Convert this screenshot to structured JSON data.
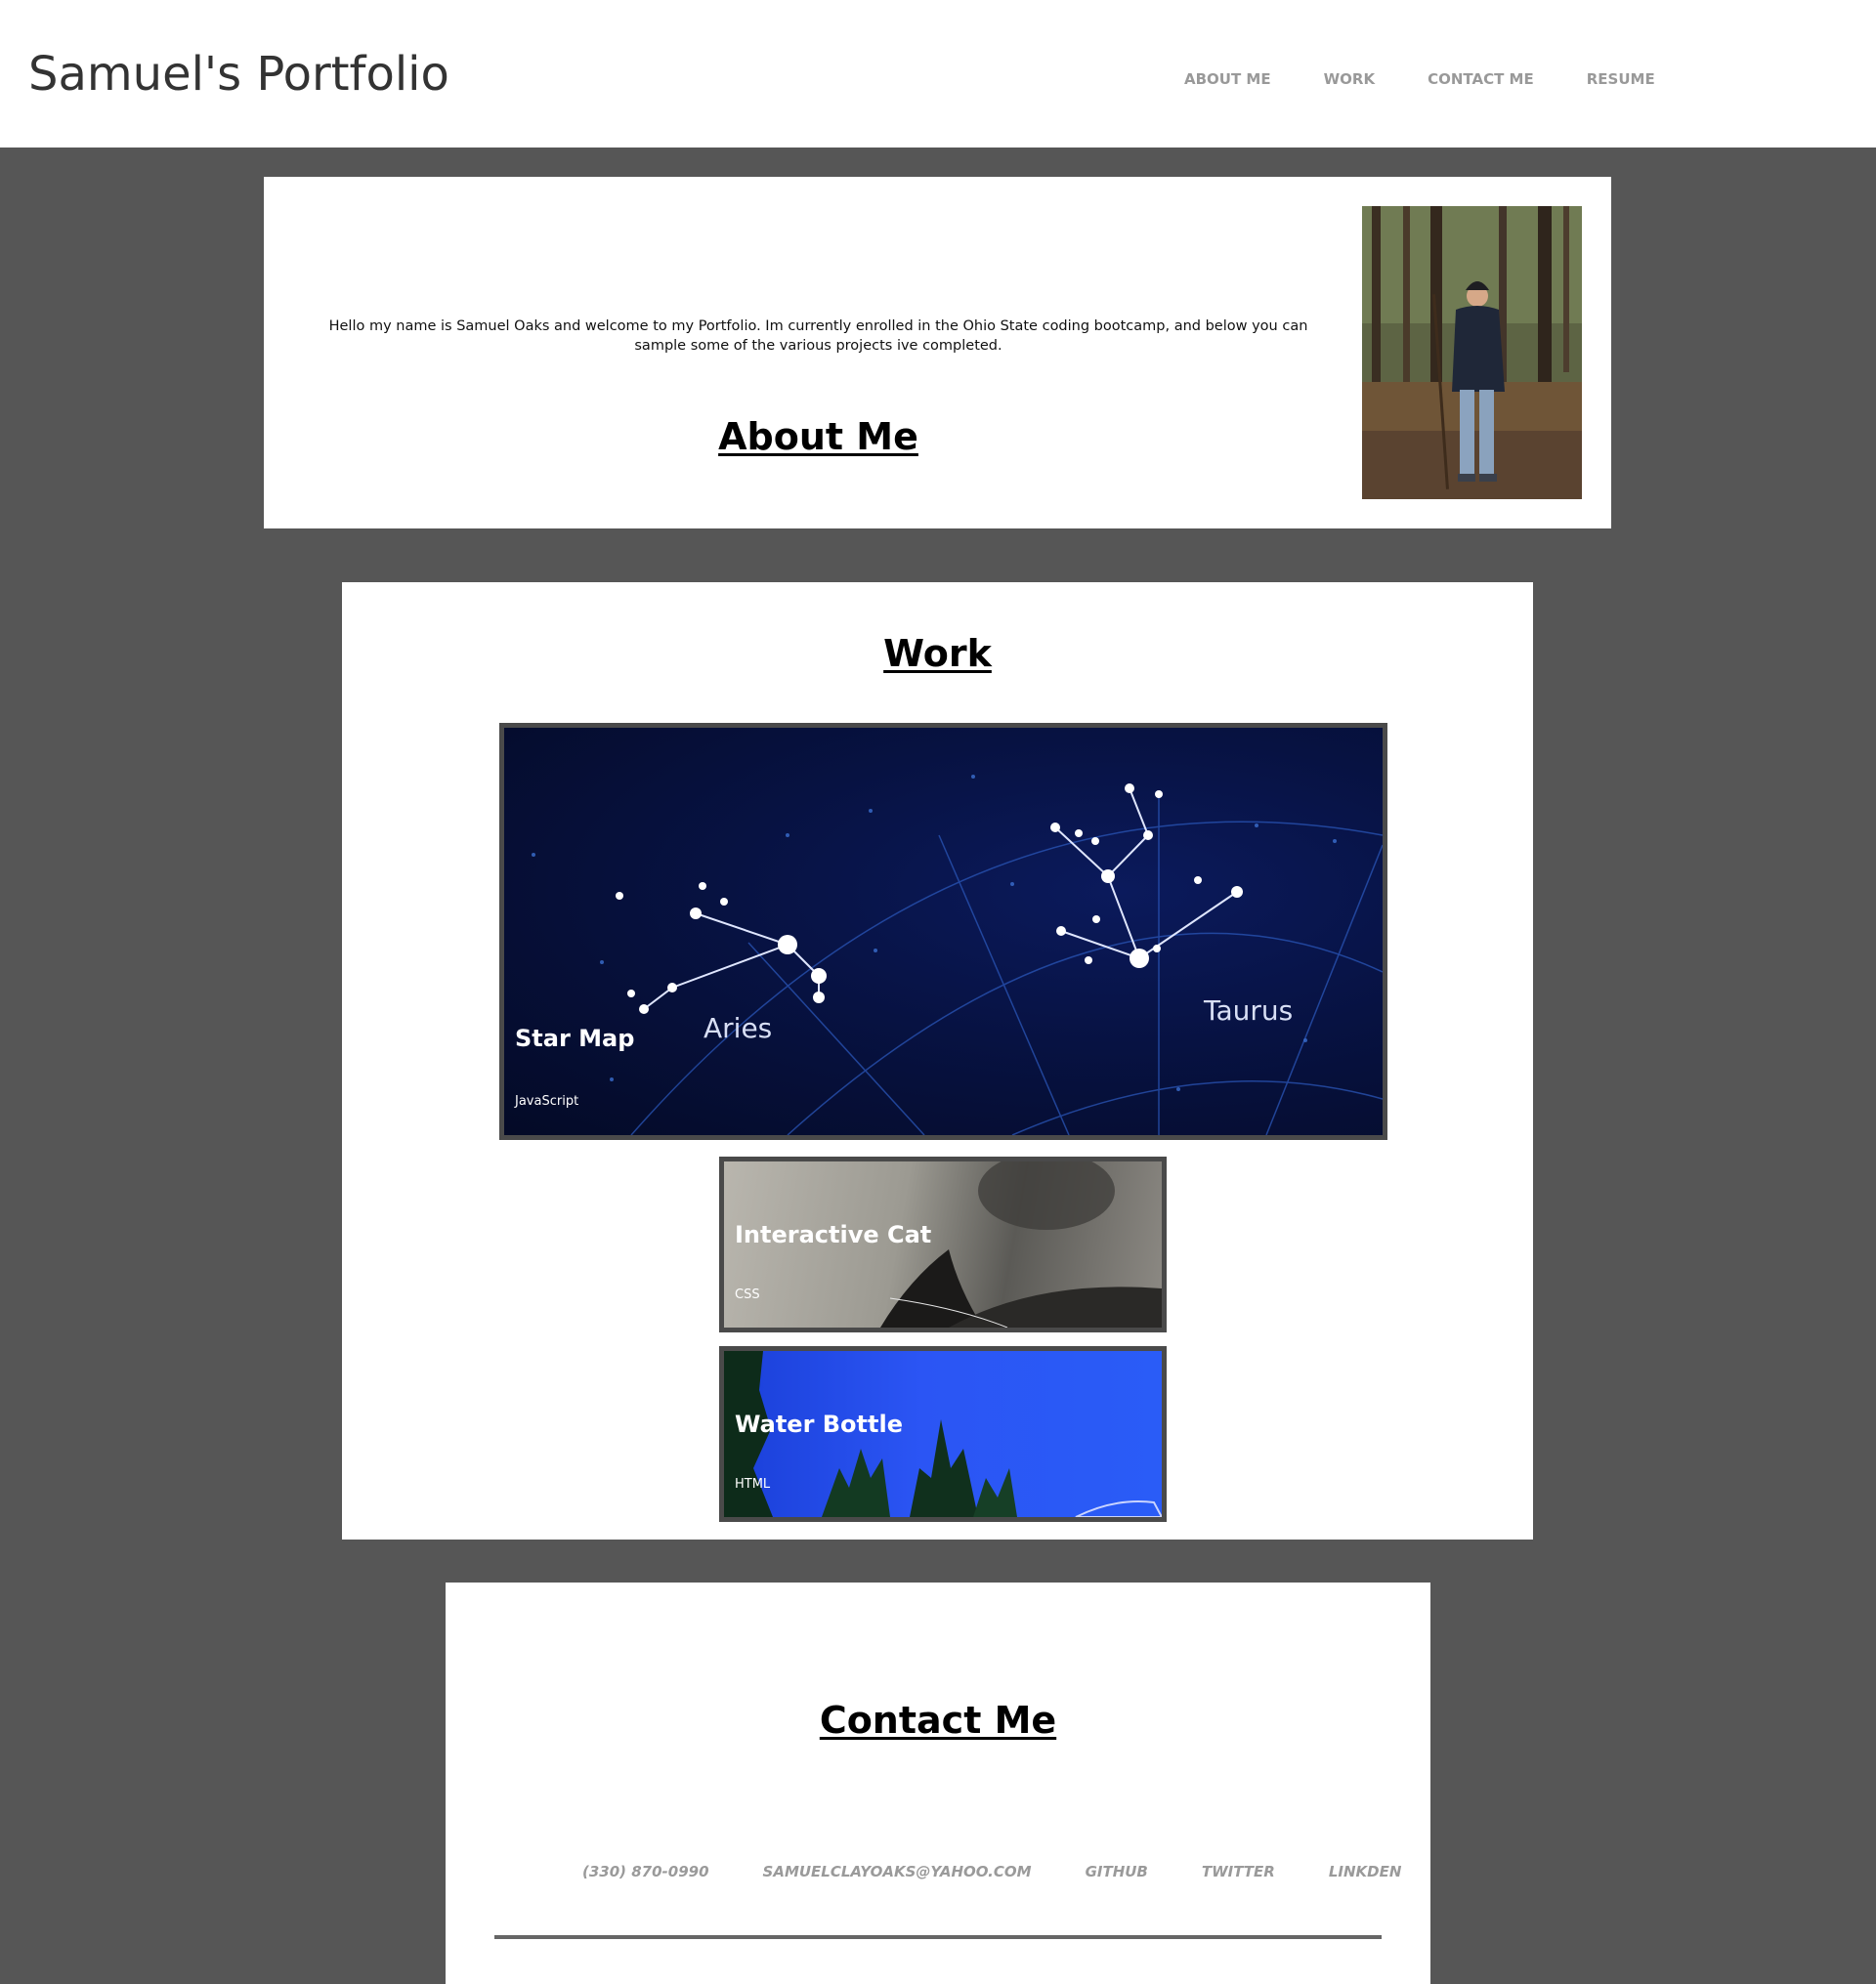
{
  "header": {
    "title": "Samuel's Portfolio",
    "nav": [
      {
        "label": "ABOUT ME"
      },
      {
        "label": "WORK"
      },
      {
        "label": "CONTACT ME"
      },
      {
        "label": "RESUME"
      }
    ]
  },
  "about": {
    "heading": "About Me",
    "text": "Hello my name is Samuel Oaks and welcome to my Portfolio. Im currently enrolled in the Ohio State coding bootcamp, and below you can sample some of the various projects ive completed."
  },
  "work": {
    "heading": "Work",
    "projects": [
      {
        "title": "Star Map",
        "tech": "JavaScript",
        "image_labels": [
          "Aries",
          "Taurus"
        ]
      },
      {
        "title": "Interactive Cat",
        "tech": "CSS"
      },
      {
        "title": "Water Bottle",
        "tech": "HTML"
      }
    ]
  },
  "contact": {
    "heading": "Contact Me",
    "links": [
      {
        "label": "(330) 870-0990"
      },
      {
        "label": "SAMUELCLAYOAKS@YAHOO.COM"
      },
      {
        "label": "GITHUB"
      },
      {
        "label": "TWITTER"
      },
      {
        "label": "LINKDEN"
      }
    ]
  },
  "colors": {
    "page_background": "#565656",
    "card_background": "#ffffff",
    "nav_text": "#999999",
    "title_text": "#333333"
  }
}
